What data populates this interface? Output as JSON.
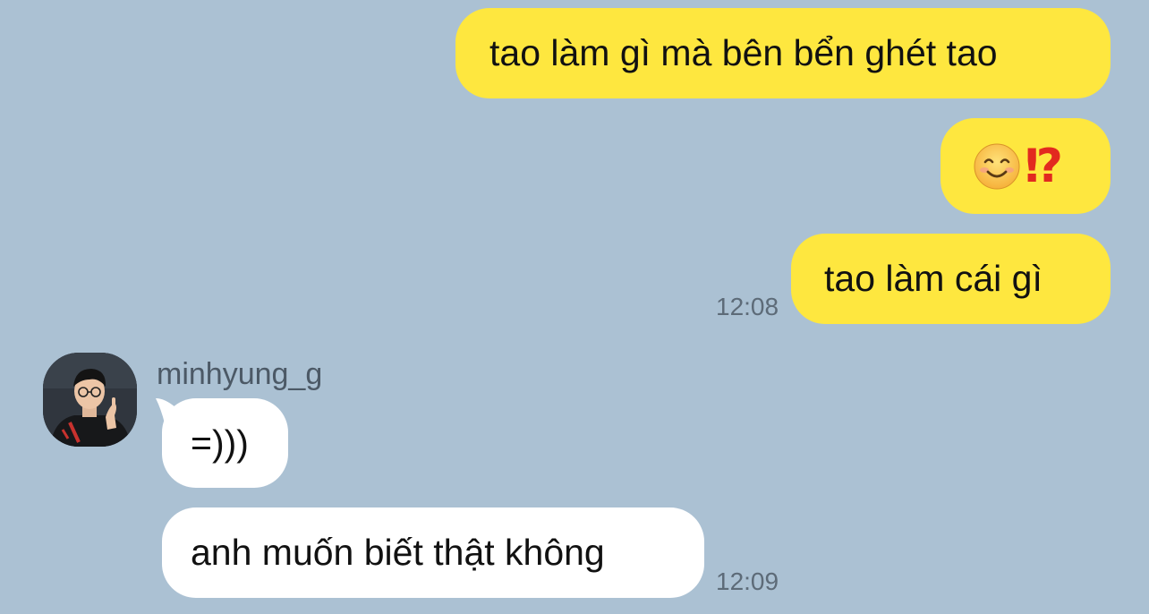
{
  "messages": {
    "outgoing": [
      {
        "text": "tao làm gì mà bên bển ghét tao"
      },
      {
        "emoji": "😊",
        "symbol": "⁉"
      },
      {
        "text": "tao làm cái gì",
        "time": "12:08"
      }
    ],
    "incoming": {
      "sender": "minhyung_g",
      "items": [
        {
          "text": "=)))"
        },
        {
          "text": "anh muốn biết thật không",
          "time": "12:09"
        }
      ]
    }
  },
  "colors": {
    "background": "#abc1d3",
    "outgoing_bubble": "#fee73f",
    "incoming_bubble": "#ffffff",
    "timestamp": "#5d6b78"
  },
  "icons": {
    "avatar": "profile-photo",
    "reaction": "smiling-face-emoji"
  }
}
